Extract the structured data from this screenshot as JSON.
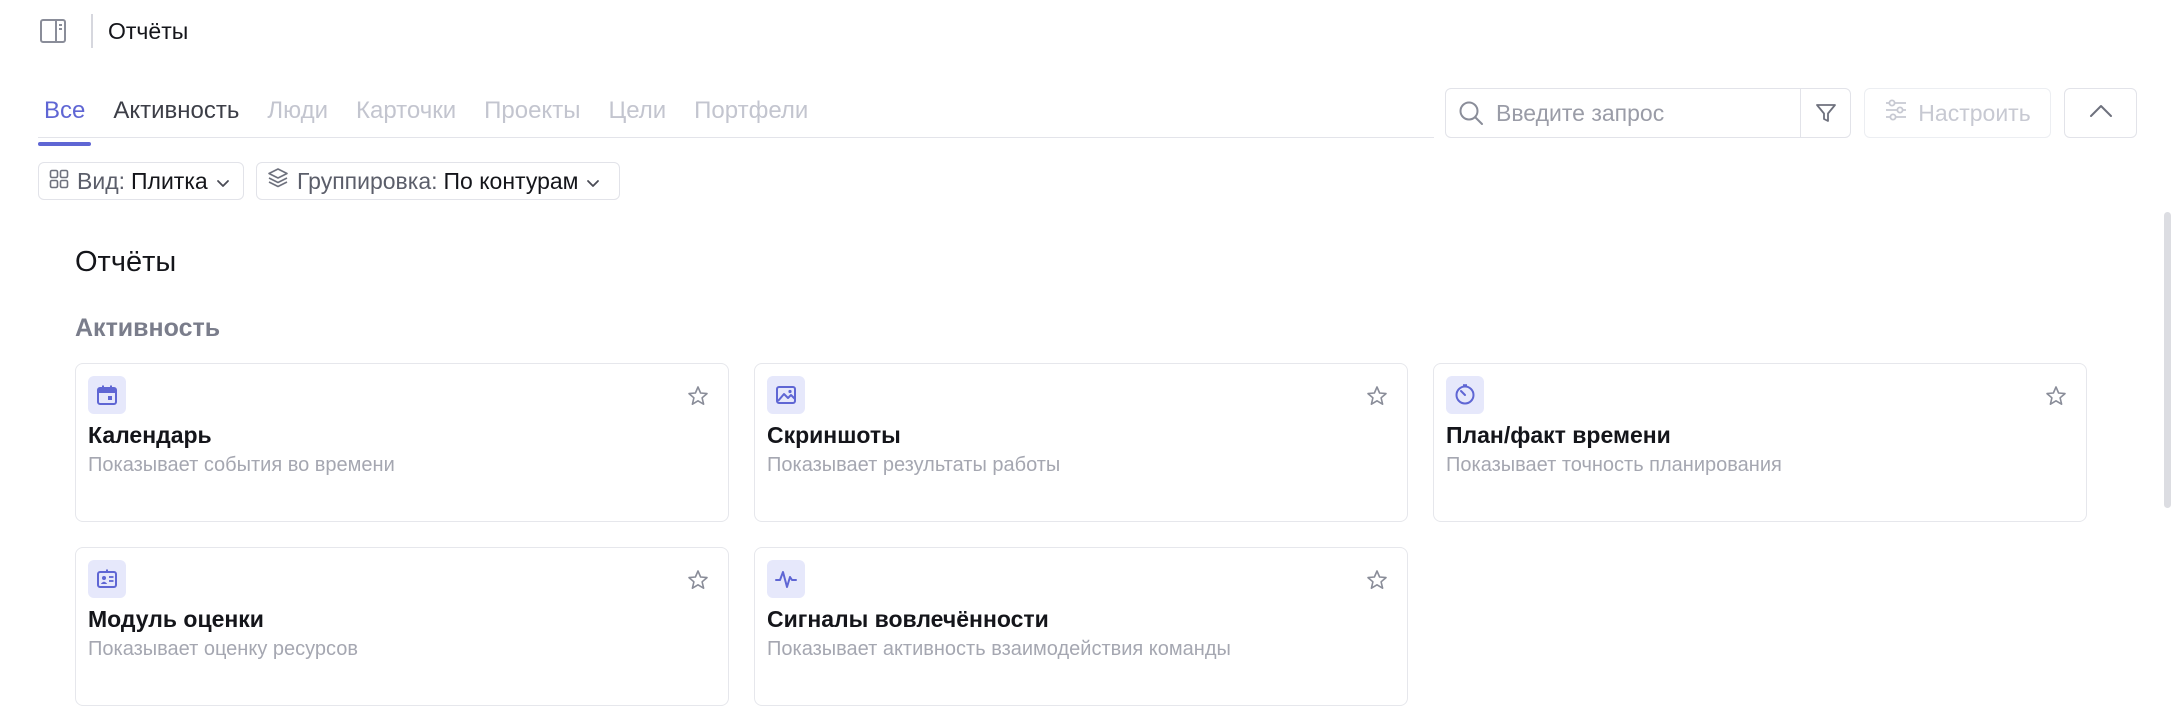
{
  "header": {
    "panel_toggle_icon": "sidebar-panel-icon",
    "breadcrumb": "Отчёты"
  },
  "tabs": [
    {
      "label": "Все",
      "state": "active"
    },
    {
      "label": "Активность",
      "state": "normal"
    },
    {
      "label": "Люди",
      "state": "disabled"
    },
    {
      "label": "Карточки",
      "state": "disabled"
    },
    {
      "label": "Проекты",
      "state": "disabled"
    },
    {
      "label": "Цели",
      "state": "disabled"
    },
    {
      "label": "Портфели",
      "state": "disabled"
    }
  ],
  "search": {
    "placeholder": "Введите запрос",
    "value": "",
    "icon": "search-icon",
    "filter_icon": "filter-icon"
  },
  "toolbar": {
    "configure_label": "Настроить",
    "configure_icon": "sliders-icon",
    "collapse_icon": "chevron-up-icon"
  },
  "view_chip": {
    "label": "Вид:",
    "value": "Плитка",
    "icon": "grid-icon"
  },
  "group_chip": {
    "label": "Группировка:",
    "value": "По контурам",
    "icon": "layers-icon"
  },
  "main": {
    "section_title": "Отчёты",
    "group_title": "Активность",
    "cards": [
      {
        "title": "Календарь",
        "description": "Показывает события во времени",
        "icon": "calendar-icon"
      },
      {
        "title": "Скриншоты",
        "description": "Показывает результаты работы",
        "icon": "image-icon"
      },
      {
        "title": "План/факт времени",
        "description": "Показывает точность планирования",
        "icon": "timer-icon"
      },
      {
        "title": "Модуль оценки",
        "description": "Показывает оценку ресурсов",
        "icon": "id-card-icon"
      },
      {
        "title": "Сигналы вовлечённости",
        "description": "Показывает активность взаимодействия команды",
        "icon": "pulse-icon"
      }
    ]
  },
  "colors": {
    "accent": "#5f66d4",
    "icon_bg": "#e6e8fb",
    "muted_text": "#a5a7b1",
    "disabled_tab": "#c3c5cf",
    "border": "#e2e3e9"
  }
}
